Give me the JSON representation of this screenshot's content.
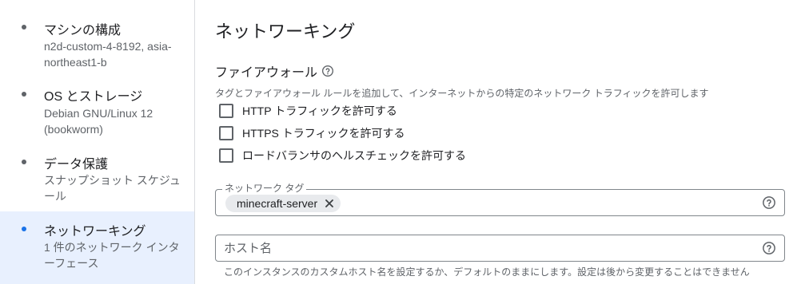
{
  "steps": [
    {
      "title": "マシンの構成",
      "subtitle": "n2d-custom-4-8192, asia-northeast1-b"
    },
    {
      "title": "OS とストレージ",
      "subtitle": "Debian GNU/Linux 12 (bookworm)"
    },
    {
      "title": "データ保護",
      "subtitle": "スナップショット スケジュール"
    },
    {
      "title": "ネットワーキング",
      "subtitle": "1 件のネットワーク インターフェース",
      "active": true
    }
  ],
  "main": {
    "title": "ネットワーキング",
    "firewall": {
      "title": "ファイアウォール",
      "description": "タグとファイアウォール ルールを追加して、インターネットからの特定のネットワーク トラフィックを許可します",
      "options": [
        {
          "label": "HTTP トラフィックを許可する",
          "checked": false
        },
        {
          "label": "HTTPS トラフィックを許可する",
          "checked": false
        },
        {
          "label": "ロードバランサのヘルスチェックを許可する",
          "checked": false
        }
      ]
    },
    "network_tags": {
      "label": "ネットワーク タグ",
      "chips": [
        "minecraft-server"
      ]
    },
    "hostname": {
      "placeholder": "ホスト名",
      "value": "",
      "hint": "このインスタンスのカスタムホスト名を設定するか、デフォルトのままにします。設定は後から変更することはできません"
    }
  },
  "icons": {
    "help": "help-circle-icon",
    "chip_remove": "close-icon",
    "step_marker": "dot-icon"
  },
  "colors": {
    "active_step_bg": "#e8f0fe",
    "active_dot": "#1a73e8",
    "text_primary": "#202124",
    "text_secondary": "#5f6368"
  }
}
